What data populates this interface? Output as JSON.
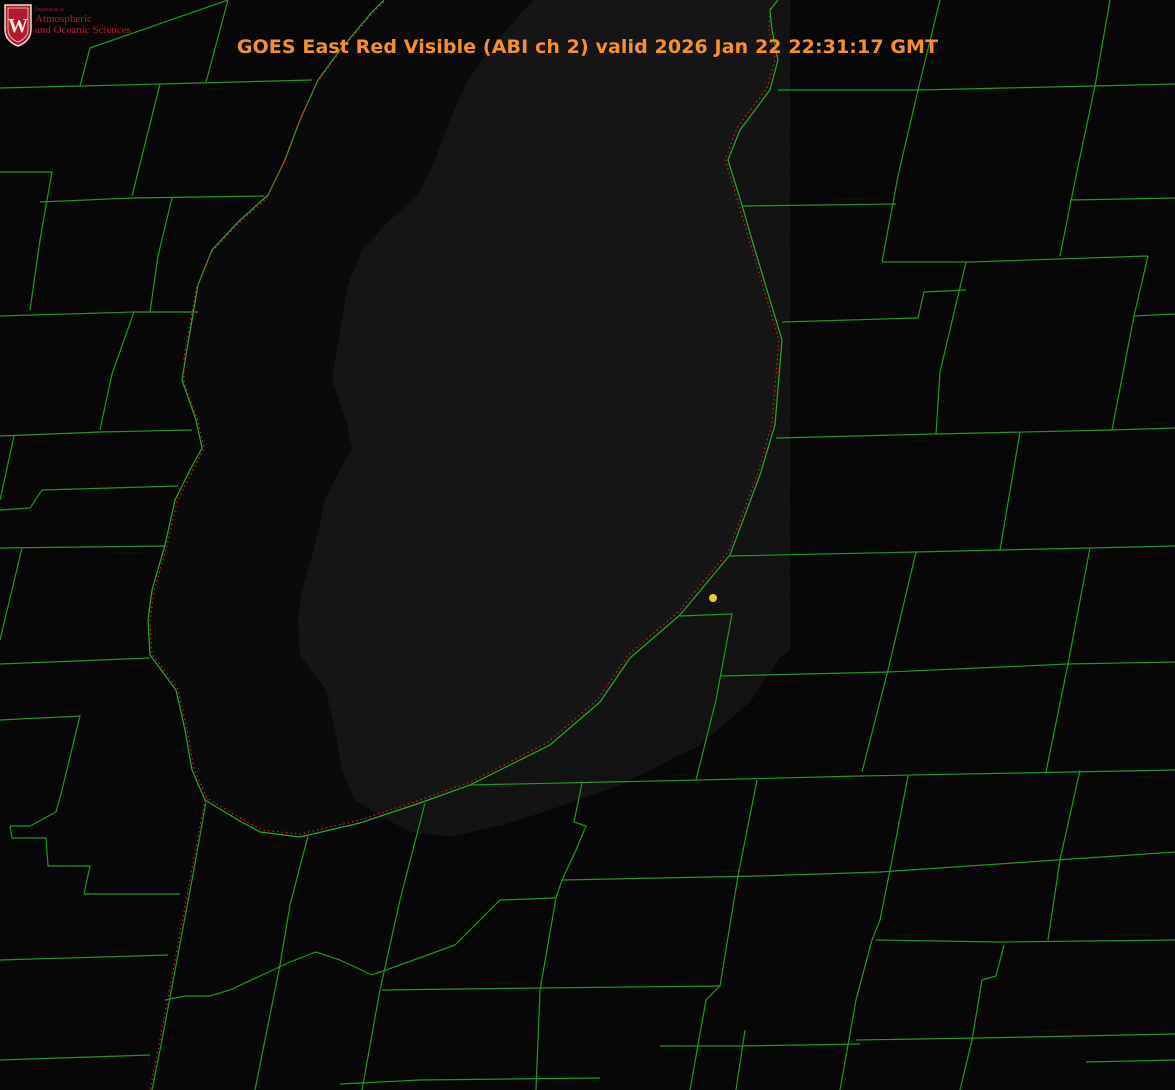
{
  "title": {
    "text": "GOES East Red Visible (ABI ch 2) valid 2026 Jan 22 22:31:17 GMT",
    "color": "#f5902b"
  },
  "logo": {
    "crest_letter": "W",
    "department": "Department of",
    "line1": "Atmospheric",
    "line2": "and Oceanic Sciences",
    "color": "#b01c2e"
  },
  "map": {
    "background_color": "#070707",
    "lake_color": "#0a0a0a",
    "county_line_color": "#1e9a1e",
    "state_line_color": "#d21f1f",
    "marker_color": "#e0d21c"
  }
}
